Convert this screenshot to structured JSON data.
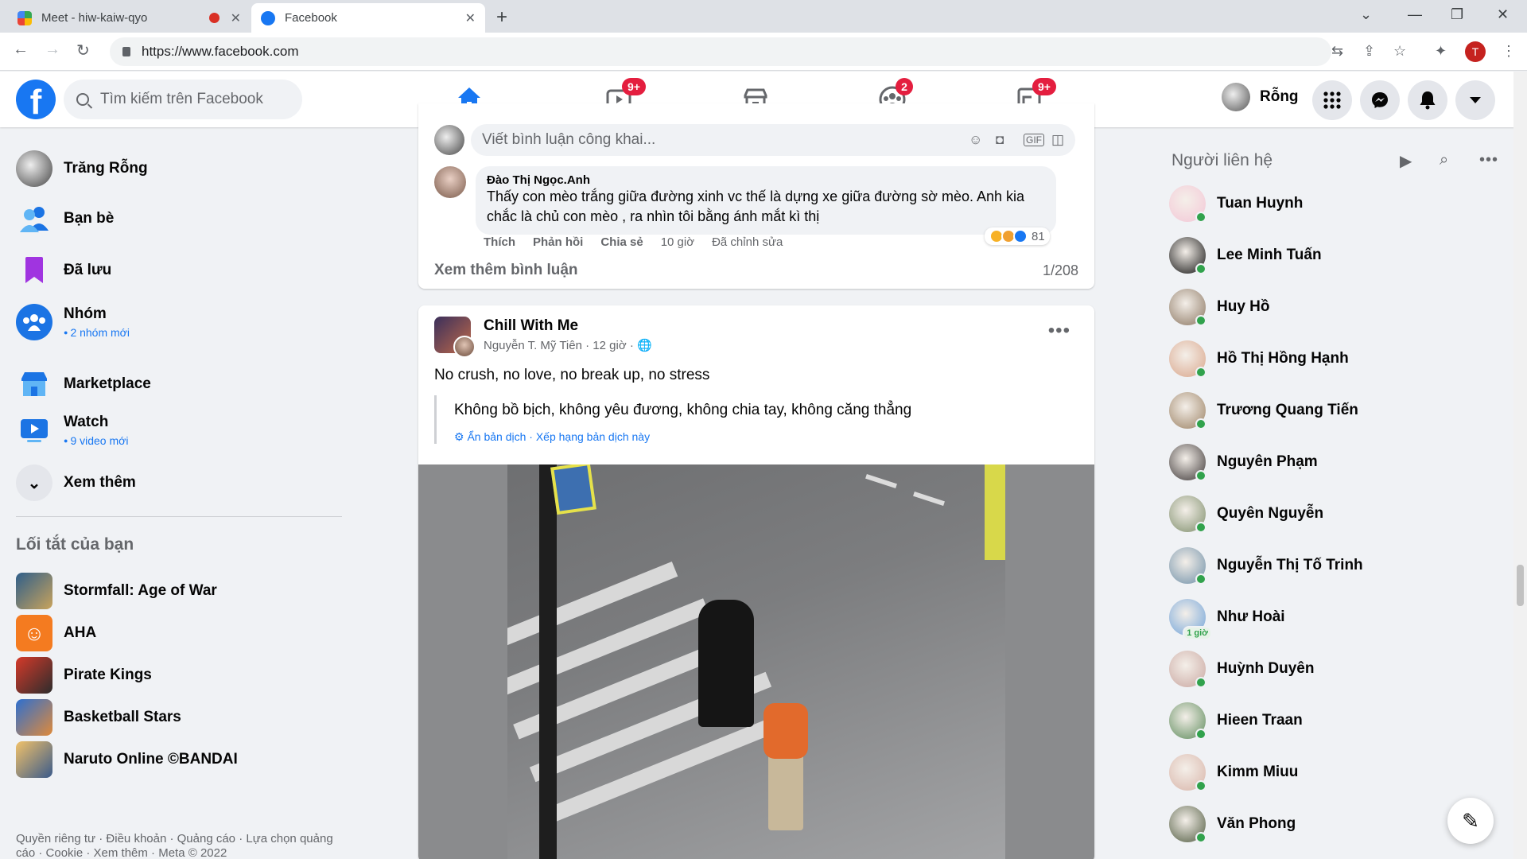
{
  "browser": {
    "tabs": [
      {
        "title": "Meet - hiw-kaiw-qyo",
        "recording": true
      },
      {
        "title": "Facebook",
        "active": true
      }
    ],
    "url": "https://www.facebook.com",
    "profile_initial": "T"
  },
  "fbnav": {
    "search_placeholder": "Tìm kiếm trên Facebook",
    "tabs": [
      {
        "name": "home",
        "badge": ""
      },
      {
        "name": "watch",
        "badge": "9+"
      },
      {
        "name": "marketplace",
        "badge": ""
      },
      {
        "name": "groups",
        "badge": "2"
      },
      {
        "name": "gaming",
        "badge": "9+"
      }
    ],
    "profile_name": "Rỗng"
  },
  "sidebar": {
    "items": [
      {
        "label": "Trăng Rỗng",
        "sub": ""
      },
      {
        "label": "Bạn bè",
        "sub": ""
      },
      {
        "label": "Đã lưu",
        "sub": ""
      },
      {
        "label": "Nhóm",
        "sub": "2 nhóm mới"
      },
      {
        "label": "Marketplace",
        "sub": ""
      },
      {
        "label": "Watch",
        "sub": "9 video mới"
      },
      {
        "label": "Xem thêm",
        "sub": ""
      }
    ],
    "shortcuts_title": "Lối tắt của bạn",
    "shortcuts": [
      {
        "label": "Stormfall: Age of War"
      },
      {
        "label": "AHA"
      },
      {
        "label": "Pirate Kings"
      },
      {
        "label": "Basketball Stars"
      },
      {
        "label": "Naruto Online ©BANDAI"
      }
    ],
    "footer": "Quyền riêng tư · Điều khoản · Quảng cáo · Lựa chọn quảng cáo · Cookie · Xem thêm · Meta © 2022"
  },
  "comment_card": {
    "input_placeholder": "Viết bình luận công khai...",
    "comment": {
      "author": "Đào Thị Ngọc.Anh",
      "text": "Thấy con mèo trắng giữa đường xinh vc thế là dựng xe giữa đường sờ mèo. Anh kia chắc là chủ con mèo , ra nhìn tôi bằng ánh mắt kì thị",
      "actions": [
        "Thích",
        "Phản hồi",
        "Chia sẻ"
      ],
      "time": "10 giờ",
      "edited": "Đã chỉnh sửa",
      "reaction_count": "81"
    },
    "more_comments": "Xem thêm bình luận",
    "comment_count": "1/208"
  },
  "post": {
    "group": "Chill With Me",
    "author": "Nguyễn T. Mỹ Tiên",
    "time": "12 giờ",
    "text": "No crush, no love, no break up, no stress",
    "translation": "Không bồ bịch, không yêu đương, không chia tay, không căng thẳng",
    "translation_links": "Ẩn bản dịch · Xếp hạng bản dịch này"
  },
  "contacts": {
    "title": "Người liên hệ",
    "list": [
      {
        "name": "Tuan Huynh",
        "color": "#f3c6d6",
        "status": "online"
      },
      {
        "name": "Lee Minh Tuấn",
        "color": "#111111",
        "status": "online"
      },
      {
        "name": "Huy Hồ",
        "color": "#8a7560",
        "status": "online"
      },
      {
        "name": "Hồ Thị Hồng Hạnh",
        "color": "#d9a58a",
        "status": "online"
      },
      {
        "name": "Trương Quang Tiến",
        "color": "#9a8062",
        "status": "online"
      },
      {
        "name": "Nguyên Phạm",
        "color": "#3b3535",
        "status": "online"
      },
      {
        "name": "Quyên Nguyễn",
        "color": "#7d8d6a",
        "status": "online"
      },
      {
        "name": "Nguyễn Thị Tố Trinh",
        "color": "#6e8fa8",
        "status": "online"
      },
      {
        "name": "Như Hoài",
        "color": "#6fa2d9",
        "status": "1 giờ"
      },
      {
        "name": "Huỳnh Duyên",
        "color": "#c9a6a0",
        "status": "online"
      },
      {
        "name": "Hieen Traan",
        "color": "#5c8a5a",
        "status": "online"
      },
      {
        "name": "Kimm Miuu",
        "color": "#d8b4a8",
        "status": "online"
      },
      {
        "name": "Văn Phong",
        "color": "#4f5a3f",
        "status": "online"
      }
    ]
  },
  "colors": {
    "brand": "#1877f2",
    "badge": "#e41e3f",
    "online": "#31a24c"
  }
}
